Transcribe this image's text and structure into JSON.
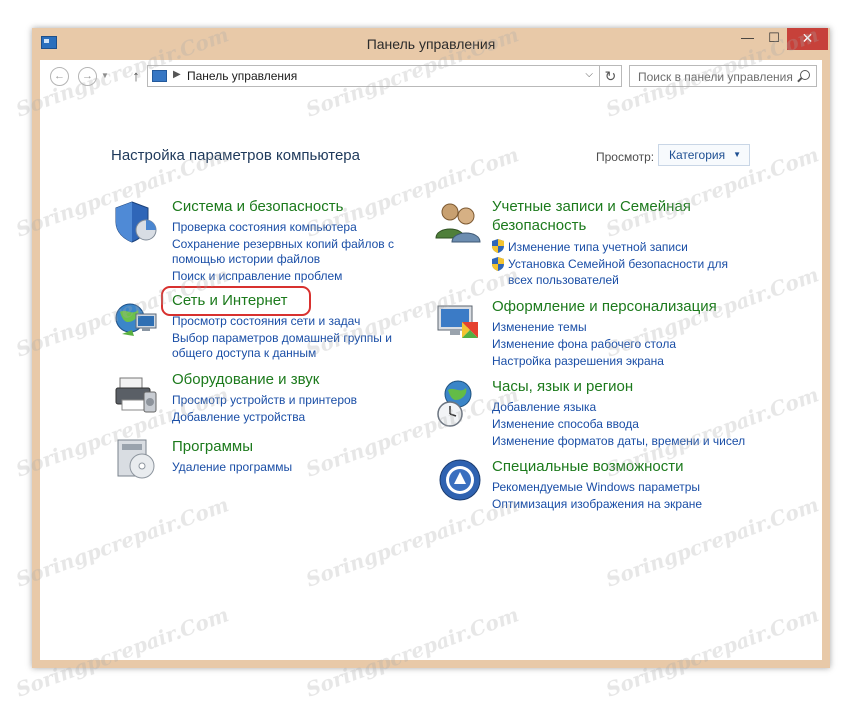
{
  "window": {
    "title": "Панель управления"
  },
  "toolbar": {
    "address_text": "Панель управления",
    "search_placeholder": "Поиск в панели управления"
  },
  "main": {
    "heading": "Настройка параметров компьютера",
    "view_label": "Просмотр:",
    "view_value": "Категория"
  },
  "left_categories": [
    {
      "title": "Система и безопасность",
      "links": [
        "Проверка состояния компьютера",
        "Сохранение резервных копий файлов с",
        "помощью истории файлов",
        "Поиск и исправление проблем"
      ]
    },
    {
      "title": "Сеть и Интернет",
      "links": [
        "Просмотр состояния сети и задач",
        "Выбор параметров домашней группы и",
        "общего доступа к данным"
      ]
    },
    {
      "title": "Оборудование и звук",
      "links": [
        "Просмотр устройств и принтеров",
        "Добавление устройства"
      ]
    },
    {
      "title": "Программы",
      "links": [
        "Удаление программы"
      ]
    }
  ],
  "right_categories": [
    {
      "title_line1": "Учетные записи и Семейная",
      "title_line2": "безопасность",
      "links": [
        "Изменение типа учетной записи",
        "Установка Семейной безопасности для",
        "всех пользователей"
      ]
    },
    {
      "title": "Оформление и персонализация",
      "links": [
        "Изменение темы",
        "Изменение фона рабочего стола",
        "Настройка разрешения экрана"
      ]
    },
    {
      "title": "Часы, язык и регион",
      "links": [
        "Добавление языка",
        "Изменение способа ввода",
        "Изменение форматов даты, времени и чисел"
      ]
    },
    {
      "title": "Специальные возможности",
      "links": [
        "Рекомендуемые Windows параметры",
        "Оптимизация изображения на экране"
      ]
    }
  ],
  "watermark": "Soringpcrepair.Com",
  "colors": {
    "category_title": "#1c7a1c",
    "link": "#1a4ea6",
    "highlight": "#d8312f",
    "close_button": "#c7413a"
  }
}
